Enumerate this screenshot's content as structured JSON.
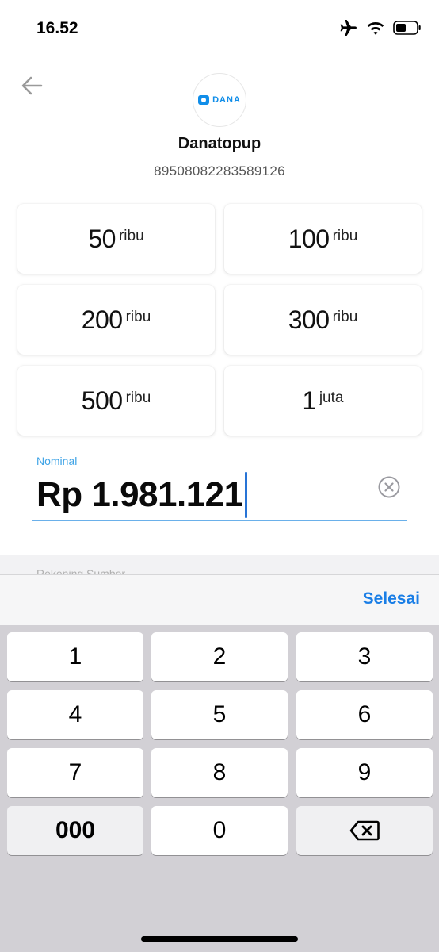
{
  "status_bar": {
    "time": "16.52"
  },
  "header": {
    "logo_text": "DANA",
    "merchant_name": "Danatopup",
    "account_number": "89508082283589126"
  },
  "amount_options": [
    {
      "value": "50",
      "unit": "ribu"
    },
    {
      "value": "100",
      "unit": "ribu"
    },
    {
      "value": "200",
      "unit": "ribu"
    },
    {
      "value": "300",
      "unit": "ribu"
    },
    {
      "value": "500",
      "unit": "ribu"
    },
    {
      "value": "1",
      "unit": "juta"
    }
  ],
  "nominal": {
    "label": "Nominal",
    "value": "Rp 1.981.121"
  },
  "hidden_section": {
    "label": "Rekening Sumber"
  },
  "keyboard": {
    "done_label": "Selesai",
    "keys": [
      "1",
      "2",
      "3",
      "4",
      "5",
      "6",
      "7",
      "8",
      "9",
      "000",
      "0"
    ]
  },
  "colors": {
    "accent": "#1a7ee6",
    "brand": "#118ee9",
    "field_line": "#6ab0ea"
  }
}
